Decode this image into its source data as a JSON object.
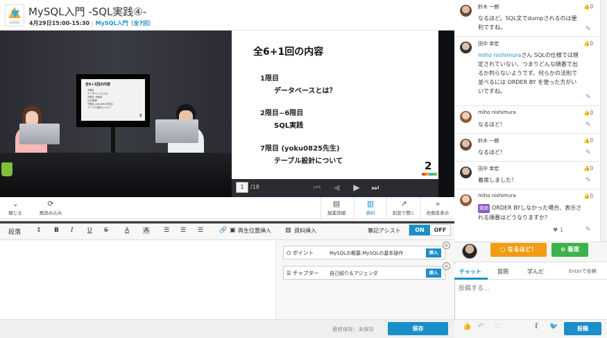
{
  "header": {
    "logo_text": "schoo",
    "title": "MySQL入門 -SQL実践④-",
    "datetime": "4月29日15:00-15:30",
    "course": "MySQL入門（全7回）"
  },
  "slide": {
    "title": "全6+1回の内容",
    "items": [
      {
        "head": "1限目",
        "sub": "データベースとは？"
      },
      {
        "head": "2限目~6限目",
        "sub": "SQL実践"
      },
      {
        "head": "7限目 (yoku0825先生)",
        "sub": "テーブル設計について"
      }
    ],
    "page_number": "2",
    "current_page": "1",
    "total_pages": "/18"
  },
  "monitor_slide": {
    "title": "全6+1回の内容",
    "lines": [
      "1限目",
      "データベースとは？",
      "2限目~6限目",
      "SQL実践",
      "7限目 (yoku0825先生)",
      "テーブル設計について"
    ],
    "num": "2"
  },
  "tools": {
    "close": "閉じる",
    "reload": "再読み込み",
    "lesson_detail": "授業詳細",
    "material": "資料",
    "open_window": "別窓で開く",
    "right_hide": "右側非表示"
  },
  "editor": {
    "paragraph": "段落",
    "insert_playpos": "再生位置挿入",
    "insert_material": "資料挿入",
    "assist": "筆記アシスト",
    "on": "ON",
    "off": "OFF"
  },
  "assist_cards": [
    {
      "label": "ポイント",
      "value": "MySQLの概要,MySQLの基本操作",
      "insert": "挿入"
    },
    {
      "label": "チャプター",
      "value": "自己紹介＆アジェンダ",
      "insert": "挿入"
    }
  ],
  "footer": {
    "last_saved": "最終保存：未保存",
    "save": "保存"
  },
  "comments": [
    {
      "name": "鈴木 一朗",
      "likes": "0",
      "mention": "",
      "badge": "",
      "text": "なるほど。SQL文でdumpされるのは便利ですね。",
      "hearts": "",
      "avatar_color": "#6b4a35"
    },
    {
      "name": "田中 幸宏",
      "likes": "0",
      "mention": "miho nishimura",
      "badge": "",
      "text": "さん SQLの仕様では規定されていない、つまりどんな順番で出るか判らないようです。何らかの法則で並べるには ORDER BY を使った方がいいですね。",
      "hearts": "",
      "avatar_color": "#7a5a3a"
    },
    {
      "name": "miho nishimura",
      "likes": "0",
      "mention": "",
      "badge": "",
      "text": "なるほど！",
      "hearts": "",
      "avatar_color": "#c58b62"
    },
    {
      "name": "鈴木 一朗",
      "likes": "0",
      "mention": "",
      "badge": "",
      "text": "なるほど！",
      "hearts": "",
      "avatar_color": "#6b4a35"
    },
    {
      "name": "田中 幸宏",
      "likes": "0",
      "mention": "",
      "badge": "",
      "text": "着席しました！",
      "hearts": "",
      "avatar_color": "#7a5a3a"
    },
    {
      "name": "miho nishimura",
      "likes": "0",
      "mention": "",
      "badge": "質問",
      "text": "ORDER BYしなかった場合、表示される順番はどうなりますか？",
      "hearts": "1",
      "avatar_color": "#c58b62"
    }
  ],
  "reactions": {
    "naruhodo": "なるほど！",
    "seat": "着席"
  },
  "chat": {
    "tab_chat": "チャット",
    "tab_question": "質問",
    "tab_learned": "学んだ",
    "enter_post": "Enterで投稿",
    "placeholder": "投稿する...",
    "post": "投稿"
  },
  "colors": {
    "accent": "#1a8fc9",
    "orange": "#f39c12",
    "green": "#3bb34a",
    "question": "#8e5bc6"
  }
}
